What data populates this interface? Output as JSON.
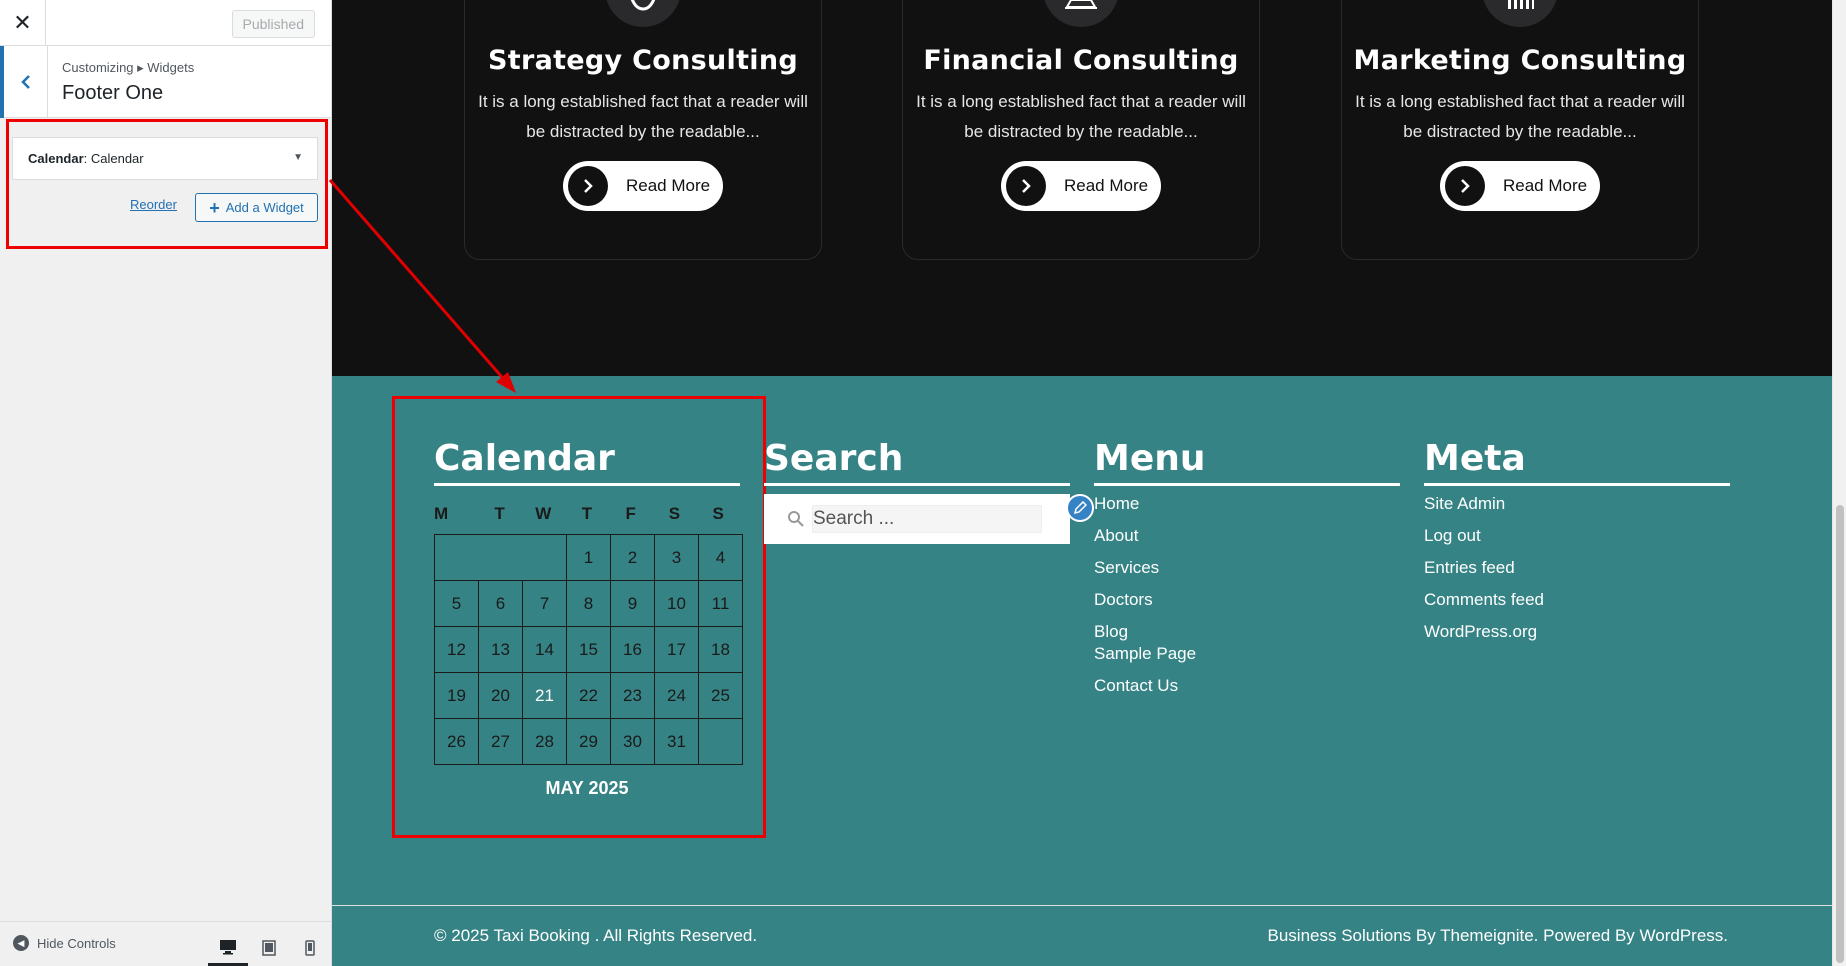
{
  "customizer": {
    "close_icon": "close-icon",
    "publish_label": "Published",
    "breadcrumb": "Customizing ▸ Widgets",
    "section_title": "Footer One",
    "widget_title_bold": "Calendar",
    "widget_title_rest": ": Calendar",
    "reorder_label": "Reorder",
    "add_widget_label": "Add a Widget",
    "hide_controls_label": "Hide Controls",
    "devices": [
      "desktop-icon",
      "tablet-icon",
      "mobile-icon"
    ]
  },
  "services": [
    {
      "title": "Strategy Consulting",
      "text": "It is a long established fact that a reader will be distracted by the readable...",
      "button": "Read More"
    },
    {
      "title": "Financial Consulting",
      "text": "It is a long established fact that a reader will be distracted by the readable...",
      "button": "Read More"
    },
    {
      "title": "Marketing Consulting",
      "text": "It is a long established fact that a reader will be distracted by the readable...",
      "button": "Read More"
    }
  ],
  "footer": {
    "calendar": {
      "title": "Calendar",
      "days": [
        "M",
        "T",
        "W",
        "T",
        "F",
        "S",
        "S"
      ],
      "weeks": [
        [
          "",
          "",
          "",
          "1",
          "2",
          "3",
          "4"
        ],
        [
          "5",
          "6",
          "7",
          "8",
          "9",
          "10",
          "11"
        ],
        [
          "12",
          "13",
          "14",
          "15",
          "16",
          "17",
          "18"
        ],
        [
          "19",
          "20",
          "21",
          "22",
          "23",
          "24",
          "25"
        ],
        [
          "26",
          "27",
          "28",
          "29",
          "30",
          "31",
          ""
        ]
      ],
      "today": "21",
      "caption": "MAY 2025"
    },
    "search": {
      "title": "Search",
      "placeholder": "Search ..."
    },
    "menu": {
      "title": "Menu",
      "items": [
        "Home",
        "About",
        "Services",
        "Doctors",
        "Blog",
        "Sample Page",
        "Contact Us"
      ]
    },
    "meta": {
      "title": "Meta",
      "items": [
        "Site Admin",
        "Log out",
        "Entries feed",
        "Comments feed",
        "WordPress.org"
      ]
    },
    "copyright": "© 2025 Taxi Booking . All Rights Reserved.",
    "credits": "Business Solutions By Themeignite. Powered By WordPress."
  },
  "colors": {
    "footer_bg": "#368385",
    "services_bg": "#111112",
    "accent": "#2271b1",
    "annotation": "#e00000"
  }
}
